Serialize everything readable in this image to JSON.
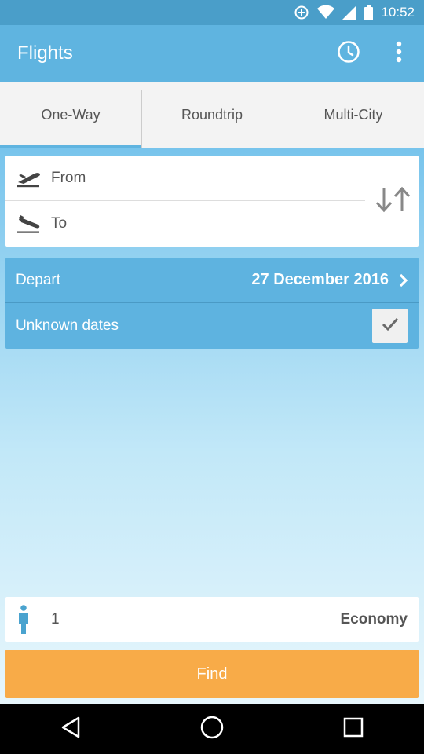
{
  "status_bar": {
    "time": "10:52",
    "icons": [
      "data-saver-icon",
      "wifi-icon",
      "signal-icon",
      "battery-icon"
    ]
  },
  "app_bar": {
    "title": "Flights",
    "actions": [
      "history-clock-icon",
      "more-vert-icon"
    ],
    "color": "#5fb4e0"
  },
  "tabs": [
    {
      "label": "One-Way",
      "active": true
    },
    {
      "label": "Roundtrip",
      "active": false
    },
    {
      "label": "Multi-City",
      "active": false
    }
  ],
  "route": {
    "from_label": "From",
    "to_label": "To",
    "from_icon": "takeoff-icon",
    "to_icon": "landing-icon",
    "swap_icon": "swap-arrows-icon"
  },
  "dates": {
    "depart_label": "Depart",
    "depart_date": "27 December 2016",
    "unknown_label": "Unknown dates",
    "unknown_checked": true
  },
  "passengers": {
    "count": "1",
    "cabin": "Economy",
    "icon": "person-icon"
  },
  "find_button": {
    "label": "Find",
    "color": "#f8ab48"
  },
  "nav_bar": {
    "buttons": [
      "back-icon",
      "home-icon",
      "recents-icon"
    ]
  }
}
